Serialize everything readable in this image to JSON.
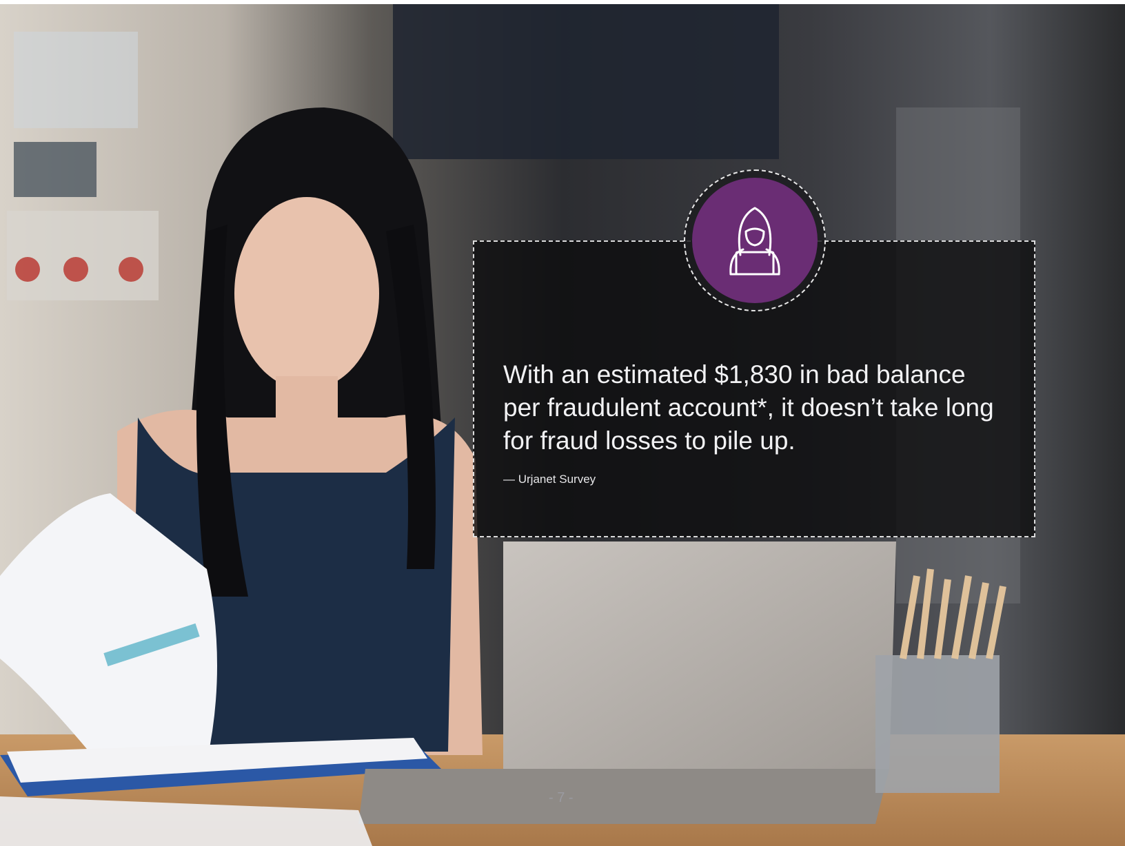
{
  "quote": {
    "text": "With an estimated $1,830 in bad balance per fraudulent account*, it doesn’t take long for fraud losses to pile up.",
    "source": "— Urjanet Survey"
  },
  "badge": {
    "icon": "hooded-hacker-laptop-icon",
    "color": "#6a2d74"
  },
  "footer": {
    "page_number": "- 7 -"
  }
}
